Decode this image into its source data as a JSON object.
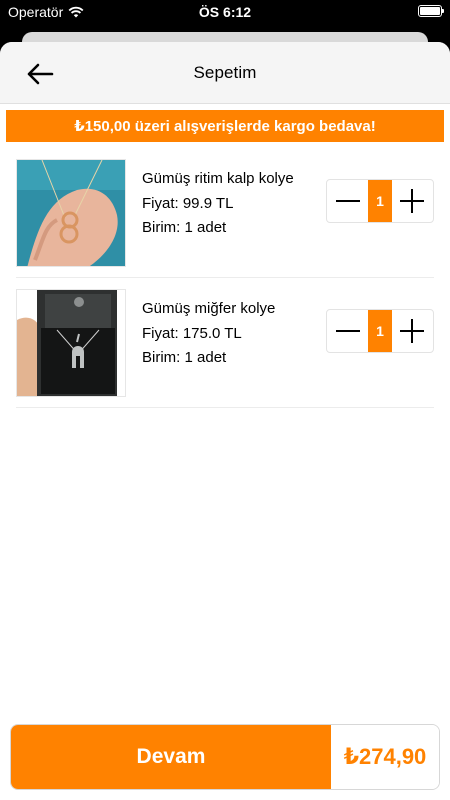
{
  "status_bar": {
    "carrier": "Operatör",
    "time": "ÖS 6:12"
  },
  "header": {
    "title": "Sepetim"
  },
  "promo": {
    "text": "₺150,00 üzeri alışverişlerde kargo bedava!"
  },
  "cart": {
    "items": [
      {
        "name": "Gümüş ritim kalp kolye",
        "price": "Fiyat: 99.9 TL",
        "unit": "Birim: 1 adet",
        "quantity": "1"
      },
      {
        "name": "Gümüş miğfer kolye",
        "price": "Fiyat: 175.0 TL",
        "unit": "Birim: 1 adet",
        "quantity": "1"
      }
    ]
  },
  "footer": {
    "continue_label": "Devam",
    "total": "₺274,90"
  },
  "colors": {
    "accent": "#ff8200"
  }
}
